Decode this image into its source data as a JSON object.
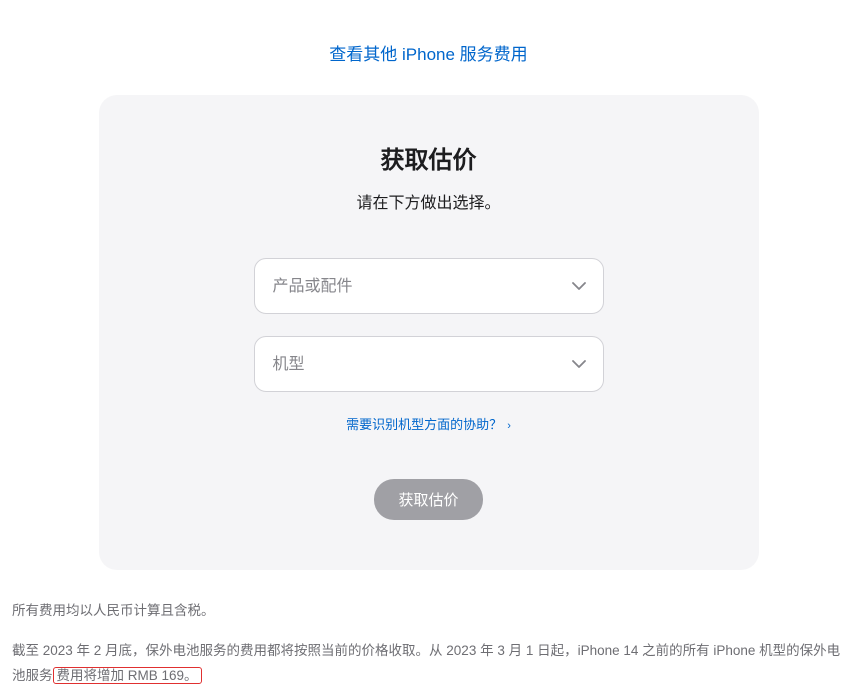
{
  "top_link": {
    "text": "查看其他 iPhone 服务费用"
  },
  "card": {
    "title": "获取估价",
    "subtitle": "请在下方做出选择。",
    "select_product": {
      "placeholder": "产品或配件"
    },
    "select_model": {
      "placeholder": "机型"
    },
    "help_link": {
      "text": "需要识别机型方面的协助？"
    },
    "submit_button": {
      "label": "获取估价"
    }
  },
  "footer": {
    "line1": "所有费用均以人民币计算且含税。",
    "line2_part1": "截至 2023 年 2 月底，保外电池服务的费用都将按照当前的价格收取。从 2023 年 3 月 1 日起，iPhone 14 之前的所有 iPhone 机型的保外电池服务",
    "line2_highlight": "费用将增加 RMB 169。"
  }
}
